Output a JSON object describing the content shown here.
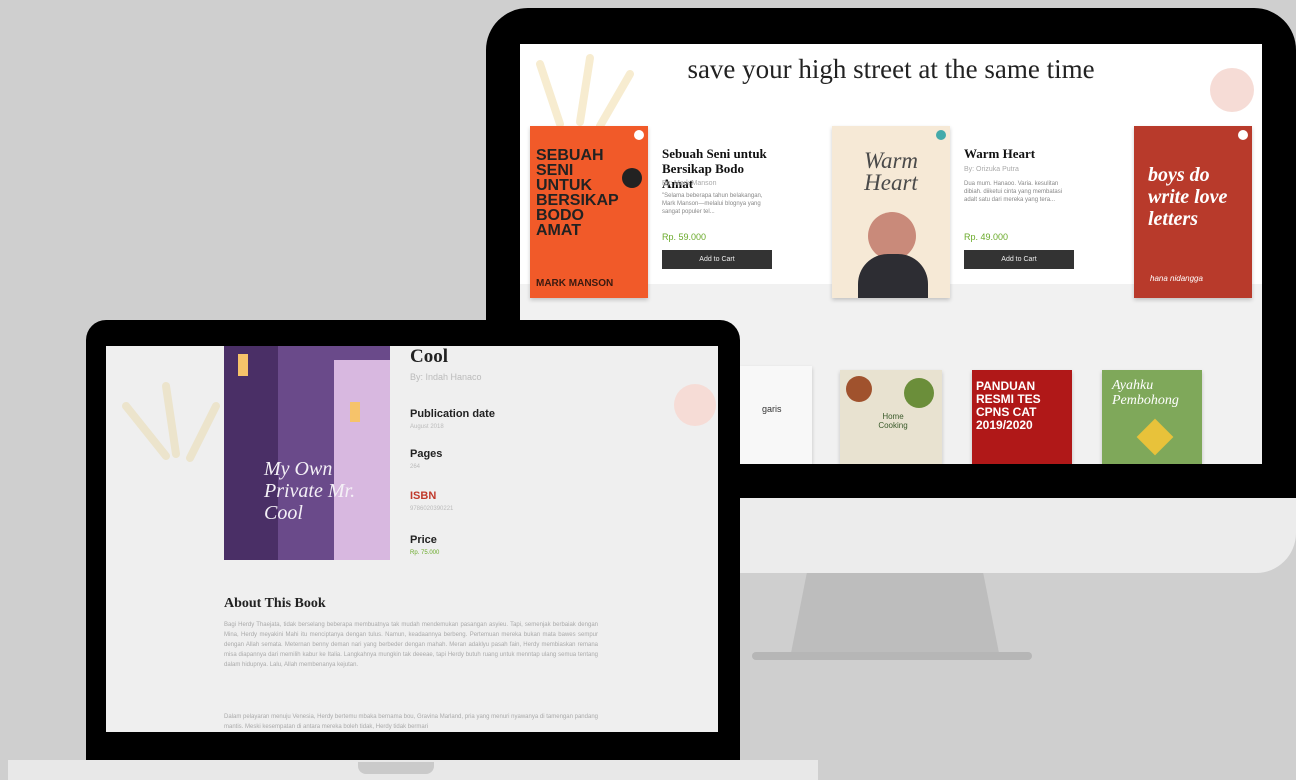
{
  "desktop": {
    "headline": "save your high street at the same time",
    "books": [
      {
        "cover_title": "SEBUAH SENI UNTUK BERSIKAP BODO AMAT",
        "cover_author": "MARK MANSON",
        "title": "Sebuah Seni untuk Bersikap Bodo Amat",
        "author": "By: Mark Manson",
        "description": "\"Selama beberapa tahun belakangan, Mark Manson—melalui blognya yang sangat populer tel...",
        "price": "Rp. 59.000",
        "cart_label": "Add to Cart"
      },
      {
        "cover_title": "Warm Heart",
        "title": "Warm Heart",
        "author": "By: Orizuka Putra",
        "description": "Dua mum. Hanaoo. Varia. kesulitan dibiah. diiketui cinta yang membatasi adalt satu dari mereka yang tera...",
        "price": "Rp. 49.000",
        "cart_label": "Add to Cart"
      },
      {
        "cover_title": "boys do write love letters",
        "cover_author": "hana nidangga"
      }
    ],
    "second_row": [
      {
        "cover_title": "garis"
      },
      {
        "cover_title": "Home Cooking"
      },
      {
        "cover_title": "PANDUAN RESMI TES CPNS CAT 2019/2020"
      },
      {
        "cover_title": "Ayahku Pembohong"
      }
    ]
  },
  "laptop": {
    "title": "Cool",
    "author": "By: Indah Hanaco",
    "cover_text": "My Own Private Mr. Cool",
    "meta": {
      "publication_label": "Publication date",
      "publication_value": "August 2018",
      "pages_label": "Pages",
      "pages_value": "264",
      "isbn_label": "ISBN",
      "isbn_value": "9786020390221",
      "price_label": "Price",
      "price_value": "Rp. 75.000"
    },
    "about_heading": "About This Book",
    "about_paragraph_1": "Bagi Herdy Thaejata, tidak berselang beberapa membuatnya tak mudah mendemukan pasangan asyieu. Tapi, semenjak berbaiak dengan Mina, Herdy meyakini Mahi itu menciptanya dengan tulus. Namun, keadaannya berbeng. Pertemuan mereka bukan mata bawes sempur dengan Allah semata. Meternan benny deman nari yang berbeder dengan mahah. Meran adaklyu pasah fain, Herdy membiaskan remana misa diapannya dari memilih kabur ke Italia. Langkahnya mungkin tak deeeae, tapi Herdy butuh ruang untuk menntap ulang semua tentang dalam hidupnya. Lalu, Allah membenanya kejutan.",
    "about_paragraph_2": "Dalam pelayaran menuju Venesia, Herdy bertemu mbaka bernama bou, Gravina Marland, pria yang menuri nyawanya di tamengan pandang mantis. Meski kesempatan di antara mereka boleh tidak, Herdy tidak bermari"
  },
  "colors": {
    "frame": "#000000",
    "price_green": "#6aaa2a",
    "isbn_red": "#c0392b",
    "cover_orange": "#f15a29",
    "cover_red": "#b83a2b"
  }
}
